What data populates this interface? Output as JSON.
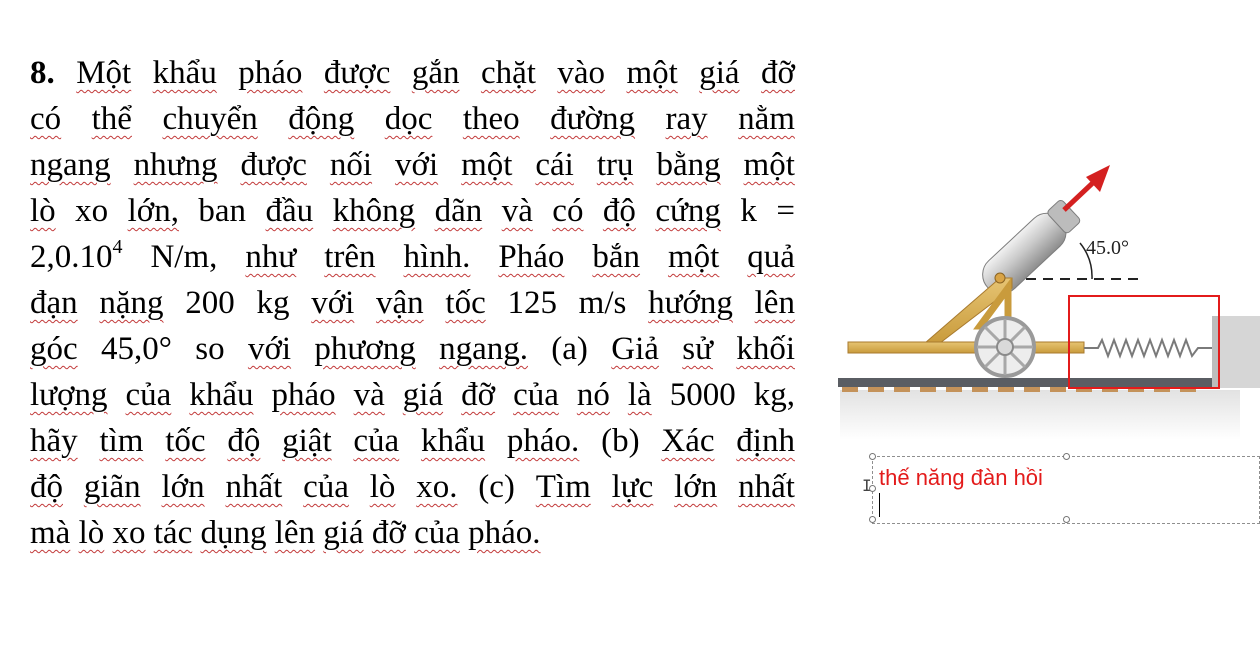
{
  "problem": {
    "lines": [
      [
        "8.",
        "Một",
        "khẩu",
        "pháo",
        "được",
        "gắn",
        "chặt",
        "vào",
        "một",
        "giá",
        "đỡ"
      ],
      [
        "có",
        "thể",
        "chuyển",
        "động",
        "dọc",
        "theo",
        "đường",
        "ray",
        "nằm"
      ],
      [
        "ngang",
        "nhưng",
        "được",
        "nối",
        "với",
        "một",
        "cái",
        "trụ",
        "bằng",
        "một"
      ],
      [
        "lò",
        "xo",
        "lớn,",
        "ban",
        "đầu",
        "không",
        "dãn",
        "và",
        "có",
        "độ",
        "cứng",
        "k",
        "="
      ],
      [
        "2,0.10",
        "N/m,",
        "như",
        "trên",
        "hình.",
        "Pháo",
        "bắn",
        "một",
        "quả"
      ],
      [
        "đạn",
        "nặng",
        "200",
        "kg",
        "với",
        "vận",
        "tốc",
        "125",
        "m/s",
        "hướng",
        "lên"
      ],
      [
        "góc",
        "45,0°",
        "so",
        "với",
        "phương",
        "ngang.",
        "(a)",
        "Giả",
        "sử",
        "khối"
      ],
      [
        "lượng",
        "của",
        "khẩu",
        "pháo",
        "và",
        "giá",
        "đỡ",
        "của",
        "nó",
        "là",
        "5000",
        "kg,"
      ],
      [
        "hãy",
        "tìm",
        "tốc",
        "độ",
        "giật",
        "của",
        "khẩu",
        "pháo.",
        "(b)",
        "Xác",
        "định"
      ],
      [
        "độ",
        "giãn",
        "lớn",
        "nhất",
        "của",
        "lò",
        "xo.",
        "(c)",
        "Tìm",
        "lực",
        "lớn",
        "nhất"
      ],
      [
        "mà",
        "lò",
        "xo",
        "tác",
        "dụng",
        "lên",
        "giá",
        "đỡ",
        "của",
        "pháo."
      ]
    ],
    "exponent": "4"
  },
  "figure": {
    "angle_label": "45.0°"
  },
  "textbox": {
    "text": "thế năng đàn hồi",
    "text_color": "#e31b1b"
  },
  "colors": {
    "highlight_box": "#e31b1b",
    "velocity_arrow": "#d42020",
    "spell_underline": "#c23a3a"
  }
}
